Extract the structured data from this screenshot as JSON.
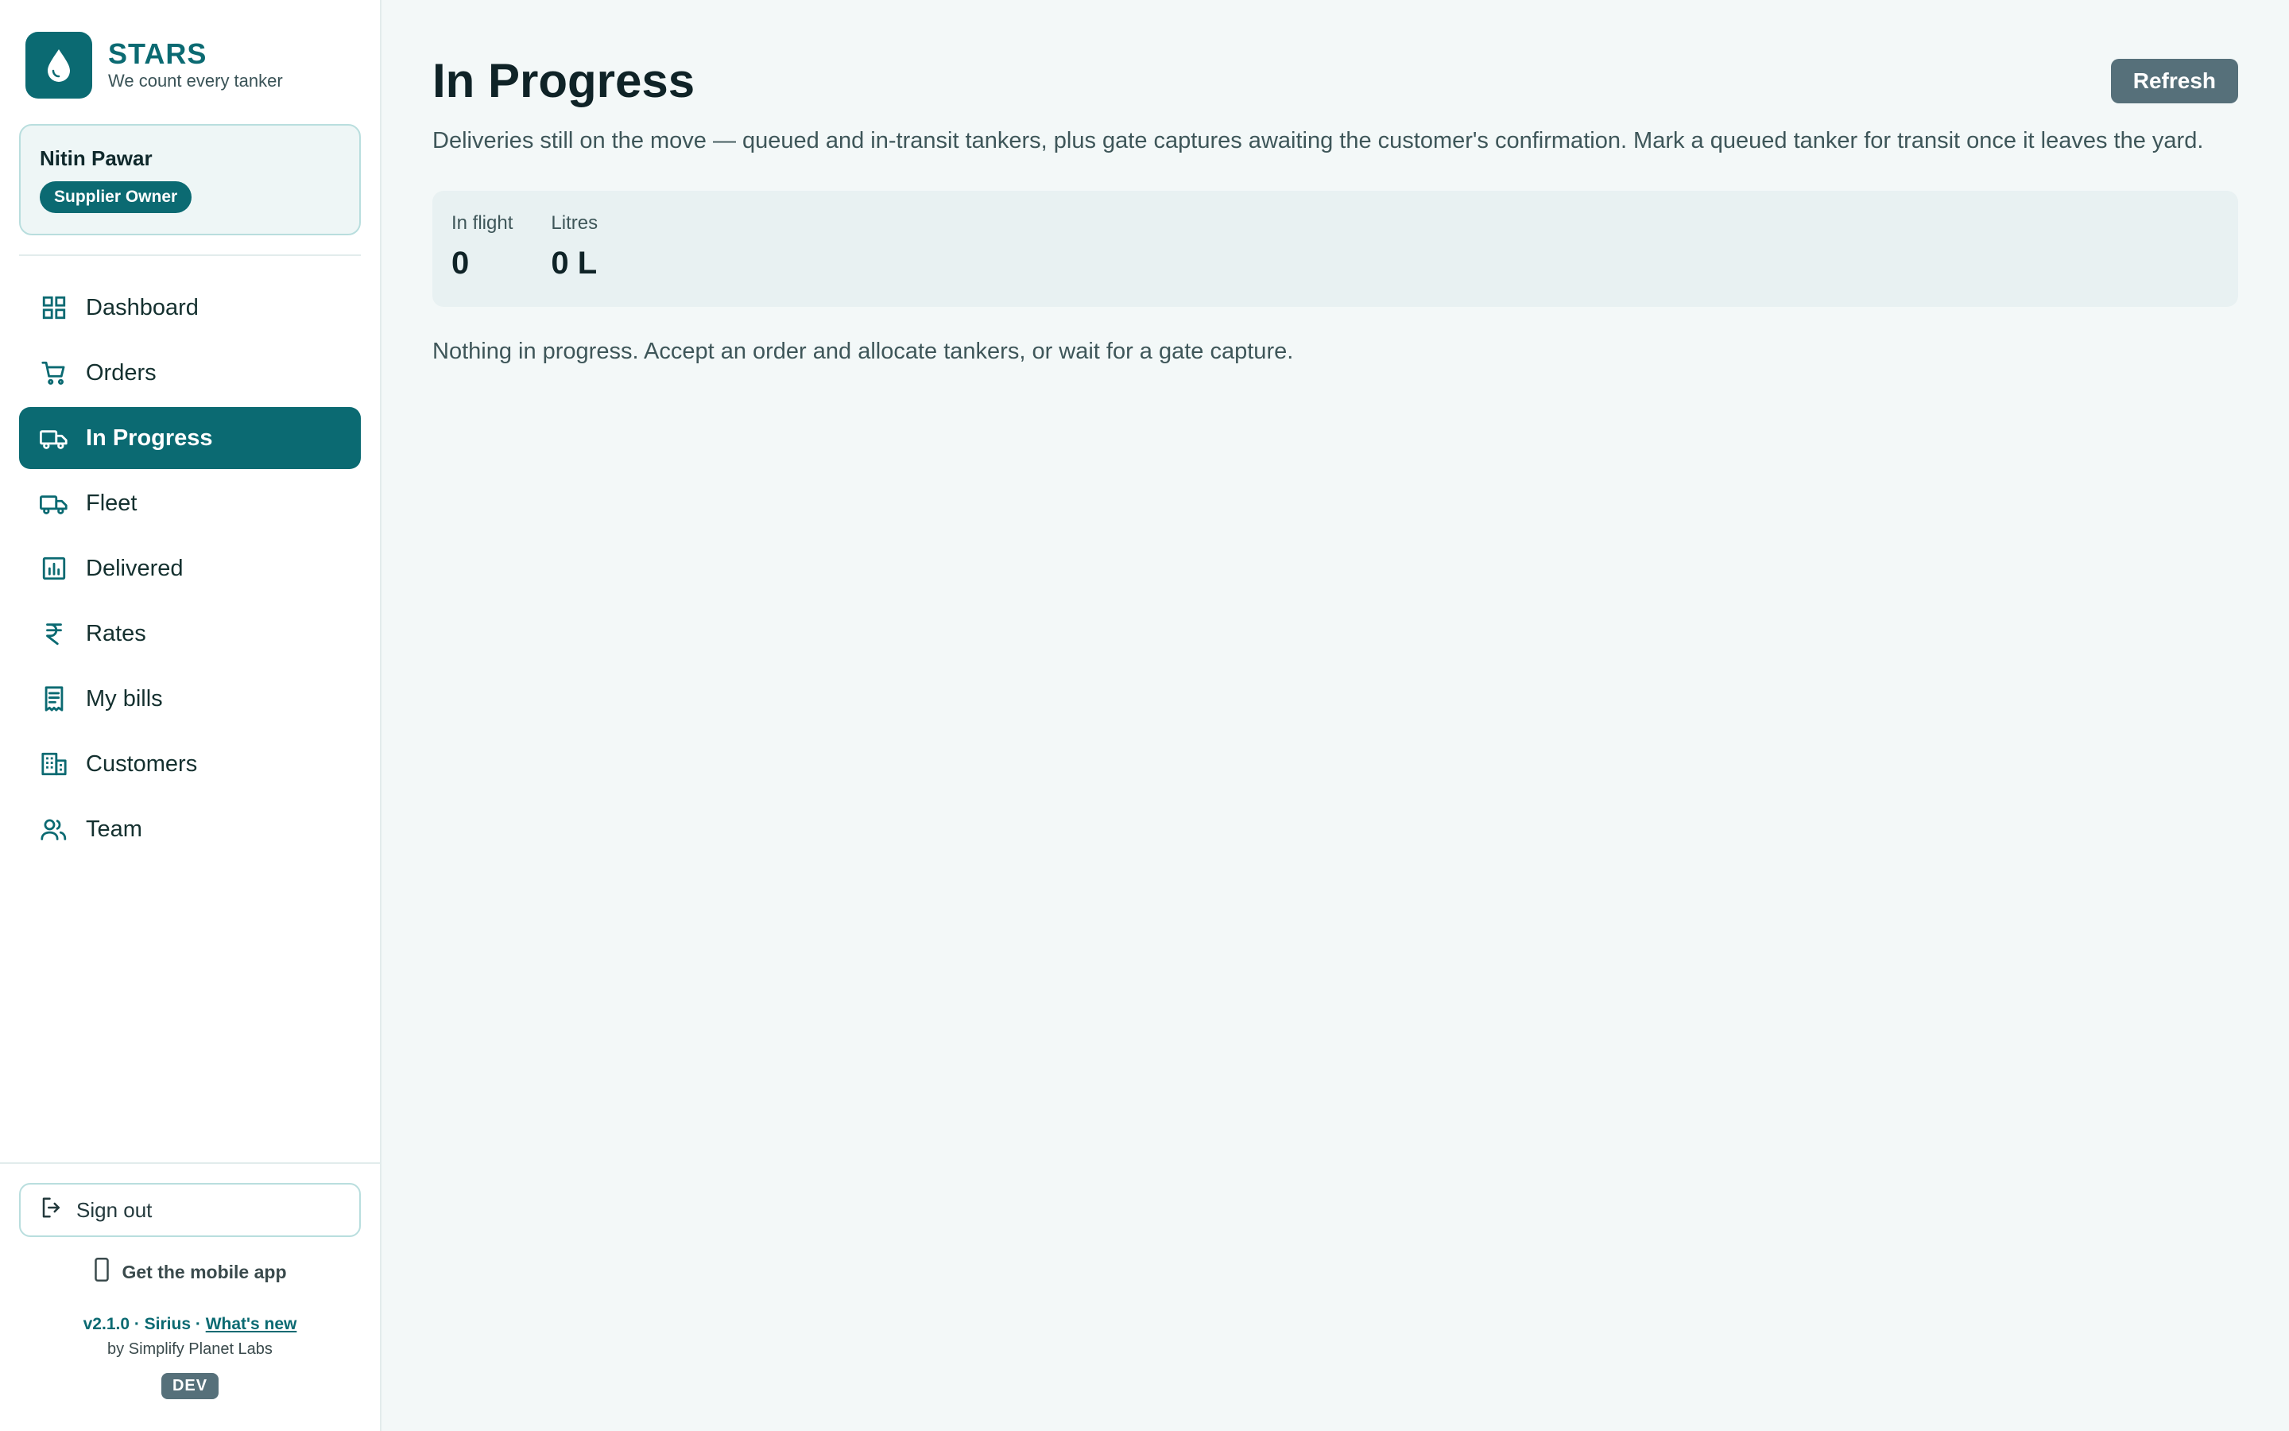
{
  "brand": {
    "name": "STARS",
    "tagline": "We count every tanker",
    "logo_icon": "water-drop-icon",
    "accent": "#0b6a72"
  },
  "user": {
    "name": "Nitin Pawar",
    "role": "Supplier Owner"
  },
  "nav": {
    "items": [
      {
        "label": "Dashboard",
        "icon": "grid-icon",
        "active": false
      },
      {
        "label": "Orders",
        "icon": "cart-icon",
        "active": false
      },
      {
        "label": "In Progress",
        "icon": "truck-icon",
        "active": true
      },
      {
        "label": "Fleet",
        "icon": "truck-icon",
        "active": false
      },
      {
        "label": "Delivered",
        "icon": "bar-chart-icon",
        "active": false
      },
      {
        "label": "Rates",
        "icon": "rupee-icon",
        "active": false
      },
      {
        "label": "My bills",
        "icon": "receipt-icon",
        "active": false
      },
      {
        "label": "Customers",
        "icon": "building-icon",
        "active": false
      },
      {
        "label": "Team",
        "icon": "users-icon",
        "active": false
      }
    ]
  },
  "footer": {
    "sign_out": "Sign out",
    "mobile_app": "Get the mobile app",
    "version": "v2.1.0 · Sirius · ",
    "whats_new": "What's new",
    "byline": "by Simplify Planet Labs",
    "env": "DEV"
  },
  "page": {
    "title": "In Progress",
    "refresh_label": "Refresh",
    "description": "Deliveries still on the move — queued and in-transit tankers, plus gate captures awaiting the customer's confirmation. Mark a queued tanker for transit once it leaves the yard.",
    "stats": [
      {
        "label": "In flight",
        "value": "0"
      },
      {
        "label": "Litres",
        "value": "0 L"
      }
    ],
    "empty_message": "Nothing in progress. Accept an order and allocate tankers, or wait for a gate capture."
  }
}
